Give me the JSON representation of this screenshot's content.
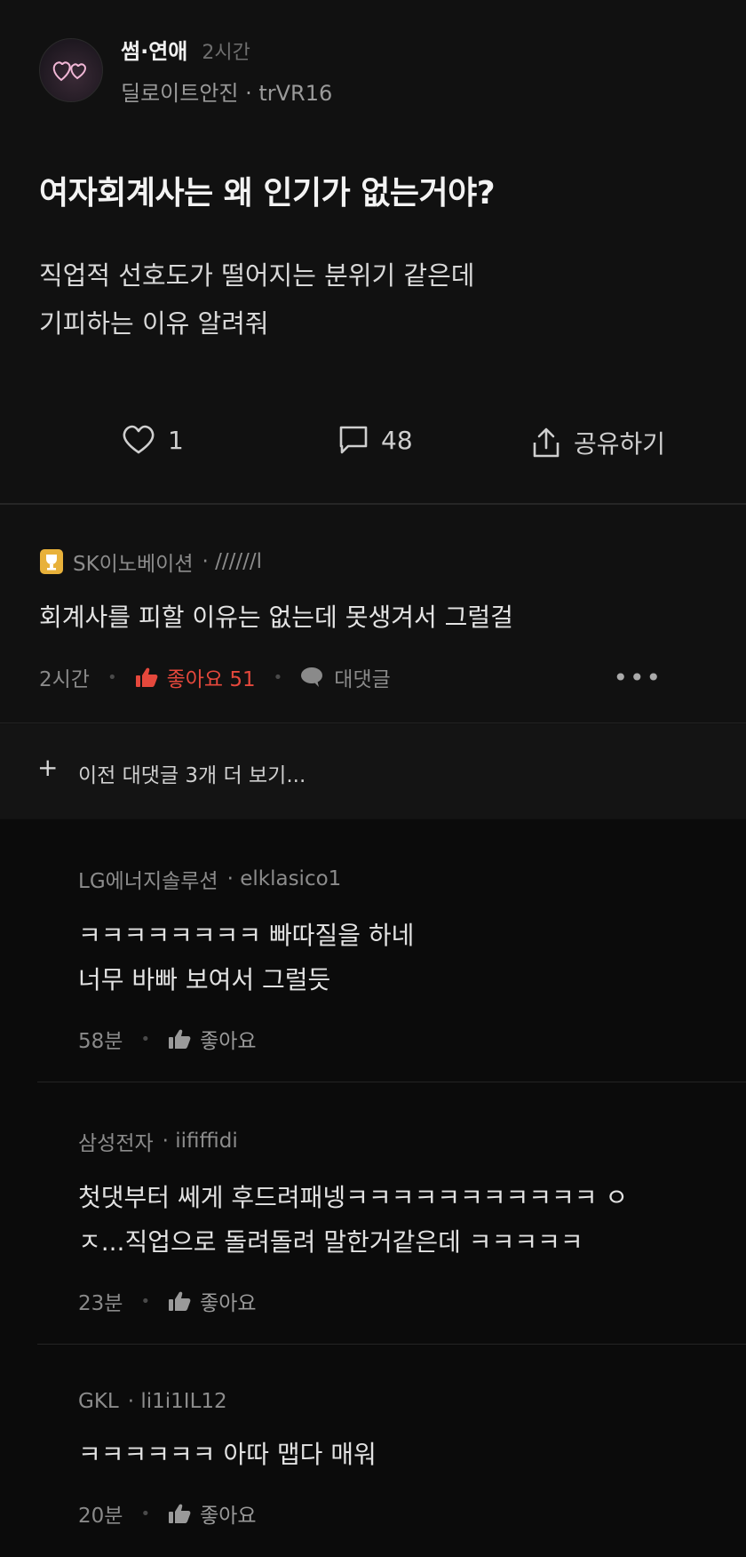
{
  "post": {
    "board": "썸·연애",
    "time": "2시간",
    "author_line": "딜로이트안진 · trVR16",
    "title": "여자회계사는 왜 인기가 없는거야?",
    "body_lines": [
      "직업적 선호도가 떨어지는 분위기 같은데",
      "기피하는 이유 알려줘"
    ],
    "likes": "1",
    "comments": "48",
    "share_label": "공유하기"
  },
  "top_comment": {
    "author": "SK이노베이션",
    "handle": "· //////l",
    "text": "회계사를 피할 이유는 없는데 못생겨서 그럴걸",
    "time": "2시간",
    "like_label": "좋아요 51",
    "reply_label": "대댓글",
    "more": "•••"
  },
  "prev_replies": {
    "plus": "+",
    "label": "이전 대댓글 3개 더 보기..."
  },
  "replies": [
    {
      "author": "LG에너지솔루션",
      "handle": "· elklasico1",
      "lines": [
        "ㅋㅋㅋㅋㅋㅋㅋㅋ 빠따질을 하네",
        "너무 바빠 보여서 그럴듯"
      ],
      "time": "58분",
      "like_label": "좋아요"
    },
    {
      "author": "삼성전자",
      "handle": "· iififfidi",
      "lines": [
        "첫댓부터 쎄게 후드려패넹ㅋㅋㅋㅋㅋㅋㅋㅋㅋㅋㅋ ㅇ",
        "ㅈ...직업으로 돌려돌려 말한거같은데 ㅋㅋㅋㅋㅋ"
      ],
      "time": "23분",
      "like_label": "좋아요"
    },
    {
      "author": "GKL",
      "handle": "· li1i1IL12",
      "lines": [
        "ㅋㅋㅋㅋㅋㅋ 아따 맵다 매워"
      ],
      "time": "20분",
      "like_label": "좋아요"
    }
  ],
  "colors": {
    "background": "#111111",
    "like_active": "#e5483c",
    "badge_gold": "#e8b13a"
  }
}
